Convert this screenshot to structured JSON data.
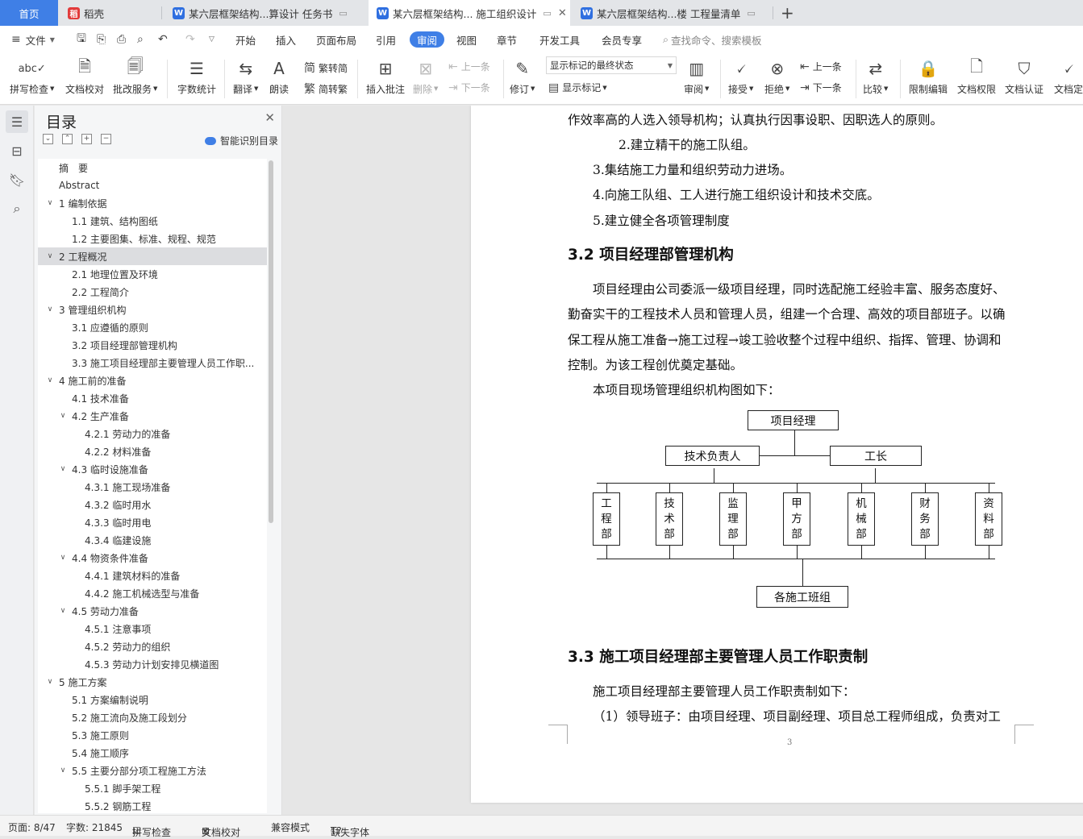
{
  "tabs": {
    "home": "首页",
    "daoke": "稻壳",
    "doc1": "某六层框架结构...算设计 任务书",
    "doc2": "某六层框架结构... 施工组织设计",
    "doc3": "某六层框架结构...楼 工程量清单",
    "new_tab": "+"
  },
  "menu": {
    "file": "文件",
    "items": [
      "开始",
      "插入",
      "页面布局",
      "引用",
      "审阅",
      "视图",
      "章节",
      "开发工具",
      "会员专享"
    ],
    "search": "查找命令、搜索模板"
  },
  "ribbon": {
    "spellcheck": "拼写检查",
    "doc_check": "文档校对",
    "revise_service": "批改服务",
    "word_count": "字数统计",
    "translate": "翻译",
    "read_aloud": "朗读",
    "trad_to_simp": "繁转简",
    "simp_to_trad": "简转繁",
    "insert_comment": "插入批注",
    "delete": "删除",
    "prev_comment": "上一条",
    "next_comment": "下一条",
    "track_changes": "修订",
    "markup_select": "显示标记的最终状态",
    "show_markup": "显示标记",
    "review": "审阅",
    "accept": "接受",
    "reject": "拒绝",
    "prev_change": "上一条",
    "next_change": "下一条",
    "compare": "比较",
    "restrict_edit": "限制编辑",
    "doc_permission": "文档权限",
    "doc_certify": "文档认证",
    "doc_final": "文档定"
  },
  "toc": {
    "title": "目录",
    "smart": "智能识别目录",
    "items": [
      {
        "text": "摘　要",
        "level": 0,
        "tog": ""
      },
      {
        "text": "Abstract",
        "level": 0,
        "tog": ""
      },
      {
        "text": "1 编制依据",
        "level": 0,
        "tog": "∨"
      },
      {
        "text": "1.1  建筑、结构图纸",
        "level": 1,
        "tog": ""
      },
      {
        "text": "1.2  主要图集、标准、规程、规范",
        "level": 1,
        "tog": ""
      },
      {
        "text": "2 工程概况",
        "level": 0,
        "tog": "∨"
      },
      {
        "text": "2.1  地理位置及环境",
        "level": 1,
        "tog": ""
      },
      {
        "text": "2.2  工程简介",
        "level": 1,
        "tog": ""
      },
      {
        "text": "3 管理组织机构",
        "level": 0,
        "tog": "∨"
      },
      {
        "text": "3.1  应遵循的原则",
        "level": 1,
        "tog": ""
      },
      {
        "text": "3.2  项目经理部管理机构",
        "level": 1,
        "tog": ""
      },
      {
        "text": "3.3  施工项目经理部主要管理人员工作职...",
        "level": 1,
        "tog": ""
      },
      {
        "text": "4 施工前的准备",
        "level": 0,
        "tog": "∨"
      },
      {
        "text": "4.1 技术准备",
        "level": 1,
        "tog": ""
      },
      {
        "text": "4.2 生产准备",
        "level": 1,
        "tog": "∨"
      },
      {
        "text": "4.2.1 劳动力的准备",
        "level": 2,
        "tog": ""
      },
      {
        "text": "4.2.2 材料准备",
        "level": 2,
        "tog": ""
      },
      {
        "text": "4.3  临时设施准备",
        "level": 1,
        "tog": "∨"
      },
      {
        "text": "4.3.1 施工现场准备",
        "level": 2,
        "tog": ""
      },
      {
        "text": "4.3.2 临时用水",
        "level": 2,
        "tog": ""
      },
      {
        "text": "4.3.3  临时用电",
        "level": 2,
        "tog": ""
      },
      {
        "text": "4.3.4 临建设施",
        "level": 2,
        "tog": ""
      },
      {
        "text": "4.4 物资条件准备",
        "level": 1,
        "tog": "∨"
      },
      {
        "text": "4.4.1  建筑材料的准备",
        "level": 2,
        "tog": ""
      },
      {
        "text": "4.4.2 施工机械选型与准备",
        "level": 2,
        "tog": ""
      },
      {
        "text": "4.5 劳动力准备",
        "level": 1,
        "tog": "∨"
      },
      {
        "text": "4.5.1  注意事项",
        "level": 2,
        "tog": ""
      },
      {
        "text": "4.5.2 劳动力的组织",
        "level": 2,
        "tog": ""
      },
      {
        "text": "4.5.3  劳动力计划安排见横道图",
        "level": 2,
        "tog": ""
      },
      {
        "text": "5 施工方案",
        "level": 0,
        "tog": "∨"
      },
      {
        "text": "5.1  方案编制说明",
        "level": 1,
        "tog": ""
      },
      {
        "text": "5.2 施工流向及施工段划分",
        "level": 1,
        "tog": ""
      },
      {
        "text": "5.3 施工原则",
        "level": 1,
        "tog": ""
      },
      {
        "text": "5.4  施工顺序",
        "level": 1,
        "tog": ""
      },
      {
        "text": "5.5 主要分部分项工程施工方法",
        "level": 1,
        "tog": "∨"
      },
      {
        "text": "5.5.1 脚手架工程",
        "level": 2,
        "tog": ""
      },
      {
        "text": "5.5.2 钢筋工程",
        "level": 2,
        "tog": ""
      }
    ]
  },
  "doc": {
    "line1": "作效率高的人选入领导机构；认真执行因事设职、因职选人的原则。",
    "line2": "2.建立精干的施工队组。",
    "line3": "3.集结施工力量和组织劳动力进场。",
    "line4": "4.向施工队组、工人进行施工组织设计和技术交底。",
    "line5": "5.建立健全各项管理制度",
    "h32": "3.2  项目经理部管理机构",
    "p1a": "项目经理由公司委派一级项目经理，同时选配施工经验丰富、服务态度好、",
    "p1b": "勤奋实干的工程技术人员和管理人员，组建一个合理、高效的项目部班子。以确",
    "p1c": "保工程从施工准备→施工过程→竣工验收整个过程中组织、指挥、管理、协调和",
    "p1d": "控制。为该工程创优奠定基础。",
    "p2": "本项目现场管理组织机构图如下：",
    "h33": "3.3  施工项目经理部主要管理人员工作职责制",
    "p3": "施工项目经理部主要管理人员工作职责制如下：",
    "p4": "（1）领导班子：由项目经理、项目副经理、项目总工程师组成，负责对工",
    "page_number": "3"
  },
  "org": {
    "top": "项目经理",
    "mid_left": "技术负责人",
    "mid_right": "工长",
    "depts": [
      [
        "工",
        "程",
        "部"
      ],
      [
        "技",
        "术",
        "部"
      ],
      [
        "监",
        "理",
        "部"
      ],
      [
        "甲",
        "方",
        "部"
      ],
      [
        "机",
        "械",
        "部"
      ],
      [
        "财",
        "务",
        "部"
      ],
      [
        "资",
        "料",
        "部"
      ]
    ],
    "bottom": "各施工班组"
  },
  "status": {
    "page": "页面: 8/47",
    "words": "字数: 21845",
    "spell": "拼写检查",
    "check": "文档校对",
    "compat": "兼容模式",
    "font": "缺失字体"
  }
}
